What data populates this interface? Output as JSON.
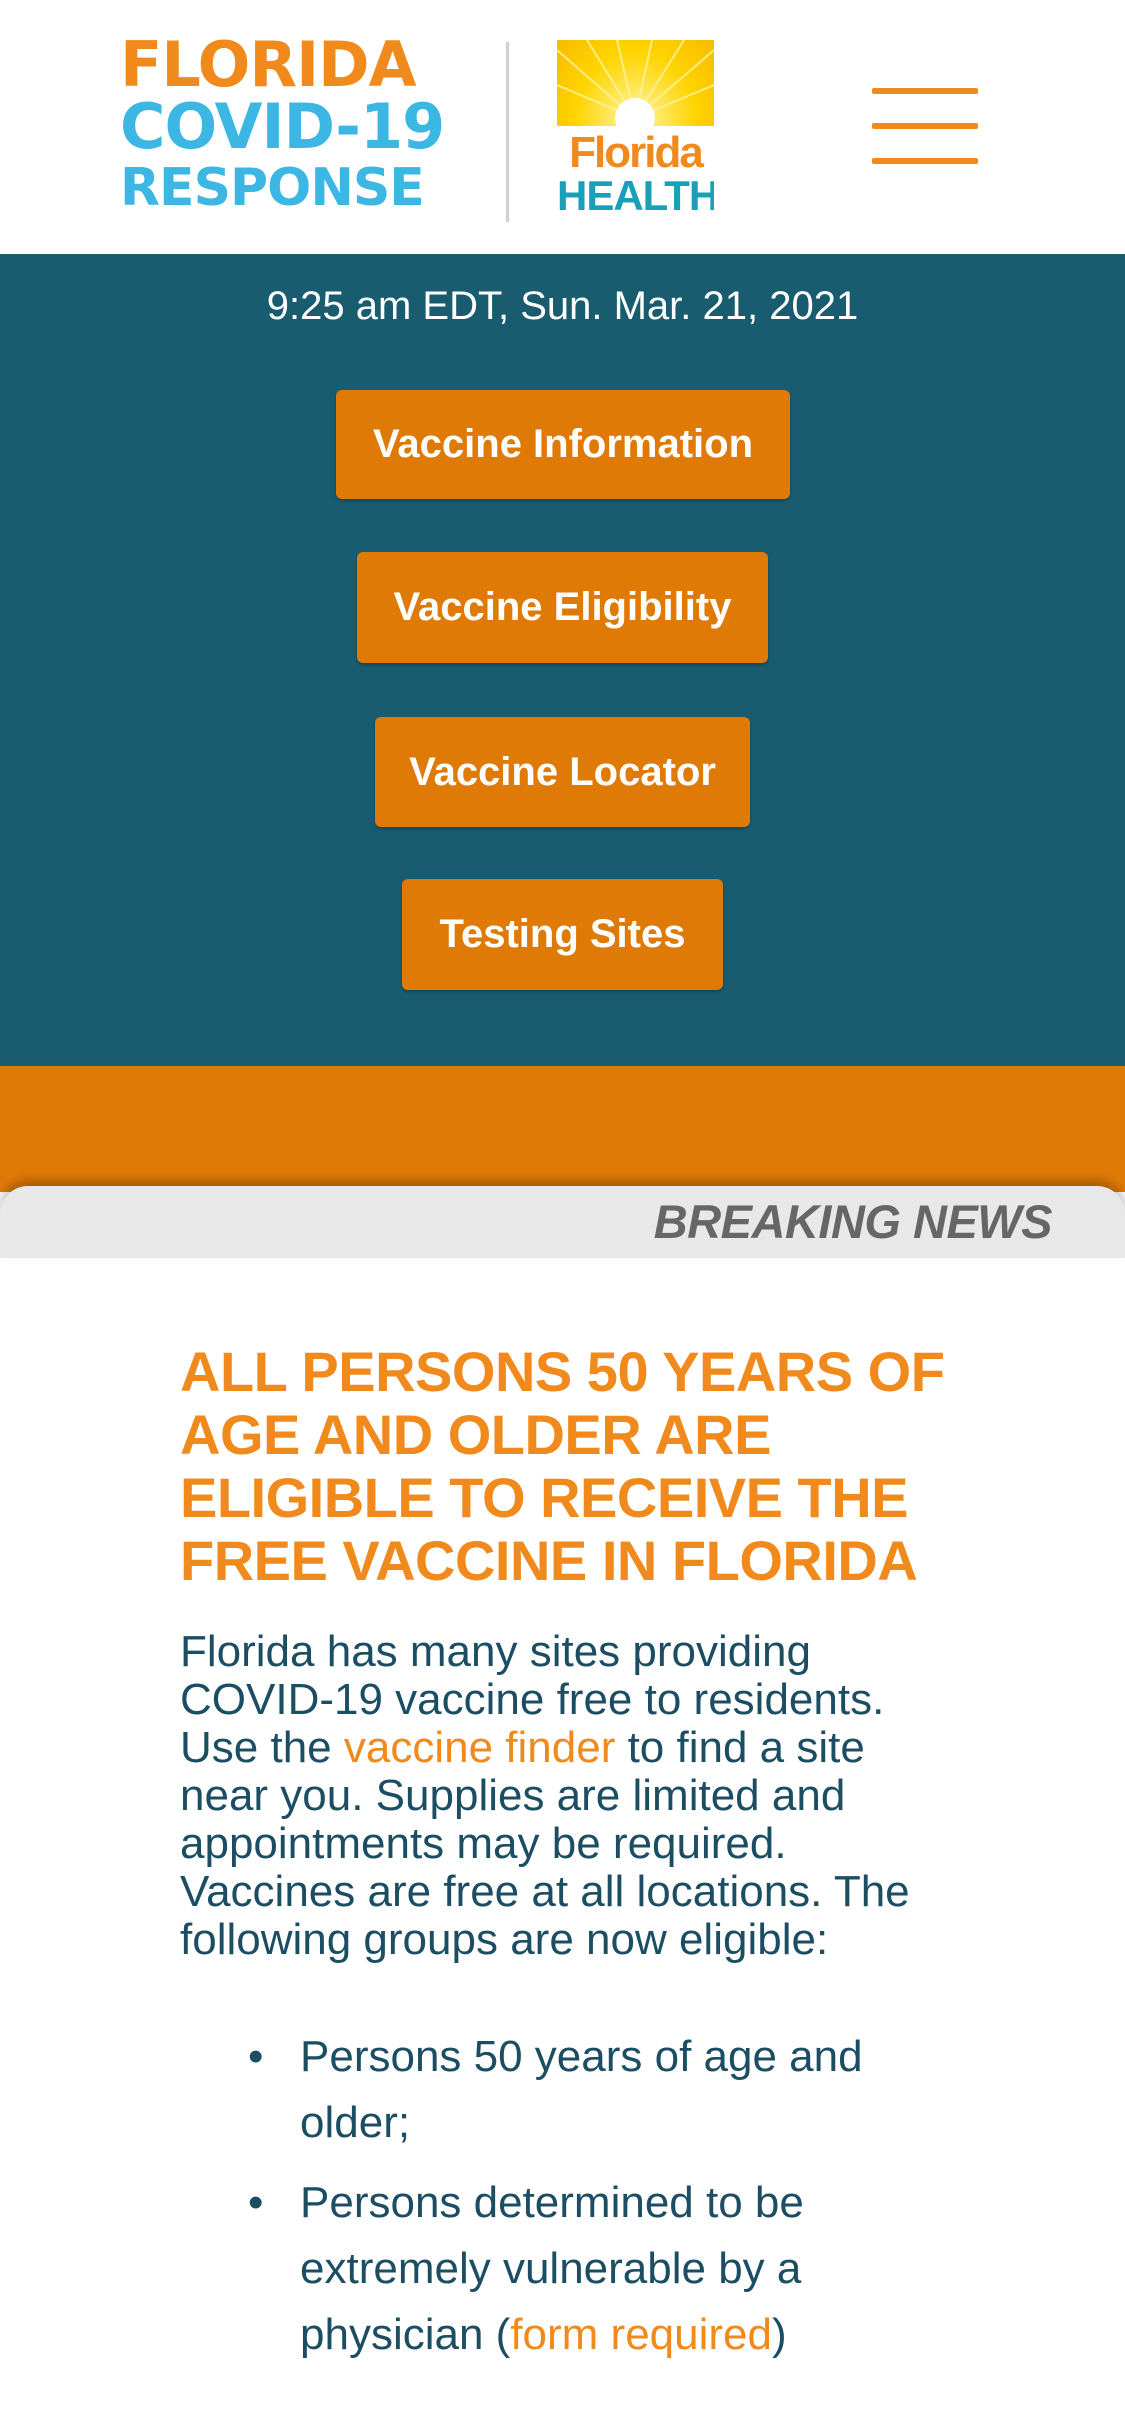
{
  "header": {
    "logo_line1": "FLORIDA",
    "logo_line2": "COVID-19",
    "logo_line3": "RESPONSE",
    "health_logo_line1": "Florida",
    "health_logo_line2": "HEALTH",
    "menu_icon": "hamburger-menu-icon"
  },
  "hero": {
    "timestamp": "9:25 am EDT, Sun. Mar. 21, 2021",
    "buttons": [
      {
        "label": "Vaccine Information"
      },
      {
        "label": "Vaccine Eligibility"
      },
      {
        "label": "Vaccine Locator"
      },
      {
        "label": "Testing Sites"
      }
    ]
  },
  "breaking_news": {
    "label": "BREAKING NEWS"
  },
  "article": {
    "headline": "ALL PERSONS 50 YEARS OF AGE AND OLDER ARE ELIGIBLE TO RECEIVE THE FREE VACCINE IN FLORIDA",
    "body_before_link": "Florida has many sites providing COVID-19 vaccine free to residents. Use the ",
    "link_text": "vaccine finder",
    "body_after_link": " to find a site near you. Supplies are limited and appointments may be required. Vaccines are free at all locations. The following groups are now eligible:",
    "groups": [
      {
        "text_before": "Persons 50 years of age and older;",
        "link": "",
        "text_after": ""
      },
      {
        "text_before": "Persons determined to be extremely vulnerable by a physician (",
        "link": "form required",
        "text_after": ")"
      }
    ]
  },
  "colors": {
    "brand_orange": "#f08a1d",
    "button_orange": "#e07a06",
    "brand_blue": "#3cb7e4",
    "hero_teal": "#195c70",
    "text_navy": "#1c4e63",
    "breaking_gray": "#e8e8e8"
  }
}
